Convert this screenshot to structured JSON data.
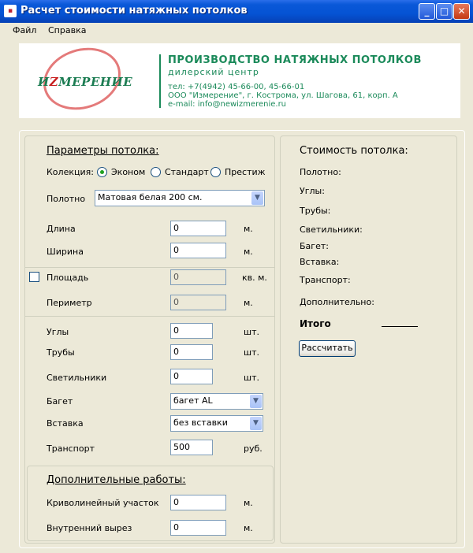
{
  "window": {
    "title": "Расчет стоимости натяжных потолков",
    "icon": "app-icon"
  },
  "menu": {
    "items": [
      "Файл",
      "Справка"
    ]
  },
  "banner": {
    "logo_text_a": "И",
    "logo_text_r": "Z",
    "logo_text_b": "МЕРЕНИЕ",
    "title": "ПРОИЗВОДСТВО НАТЯЖНЫХ ПОТОЛКОВ",
    "subtitle": "дилерский центр",
    "phone": "тел: +7(4942) 45-66-00, 45-66-01",
    "address": "ООО \"Измерение\", г. Кострома, ул. Шагова, 61, корп. А",
    "email": "e-mail: info@newizmerenie.ru"
  },
  "params": {
    "title": "Параметры потолка:",
    "collection_label": "Колекция:",
    "collection_options": [
      "Эконом",
      "Стандарт",
      "Престиж"
    ],
    "collection_selected": "Эконом",
    "canvas_label": "Полотно",
    "canvas_value": "Матовая белая 200 см.",
    "length_label": "Длина",
    "length_value": "0",
    "length_unit": "м.",
    "width_label": "Ширина",
    "width_value": "0",
    "width_unit": "м.",
    "area_label": "Площадь",
    "area_value": "0",
    "area_unit": "кв. м.",
    "area_checked": false,
    "perimeter_label": "Периметр",
    "perimeter_value": "0",
    "perimeter_unit": "м.",
    "corners_label": "Углы",
    "corners_value": "0",
    "corners_unit": "шт.",
    "pipes_label": "Трубы",
    "pipes_value": "0",
    "pipes_unit": "шт.",
    "lamps_label": "Светильники",
    "lamps_value": "0",
    "lamps_unit": "шт.",
    "baguette_label": "Багет",
    "baguette_value": "багет AL",
    "insert_label": "Вставка",
    "insert_value": "без вставки",
    "transport_label": "Транспорт",
    "transport_value": "500",
    "transport_unit": "руб."
  },
  "extra": {
    "title": "Дополнительные работы:",
    "curve_label": "Криволинейный участок",
    "curve_value": "0",
    "curve_unit": "м.",
    "cut_label": "Внутренний вырез",
    "cut_value": "0",
    "cut_unit": "м."
  },
  "cost": {
    "title": "Стоимость потолка:",
    "items": [
      "Полотно:",
      "Углы:",
      "Трубы:",
      "Светильники:",
      "Багет:",
      "Вставка:",
      "Транспорт:",
      "Дополнительно:"
    ],
    "total_label": "Итого",
    "calc_button": "Рассчитать"
  },
  "colors": {
    "titlebar": "#0553D4",
    "banner_green": "#1B8A5A",
    "logo_red": "#C81F1F",
    "window_bg": "#ECE9D8"
  }
}
